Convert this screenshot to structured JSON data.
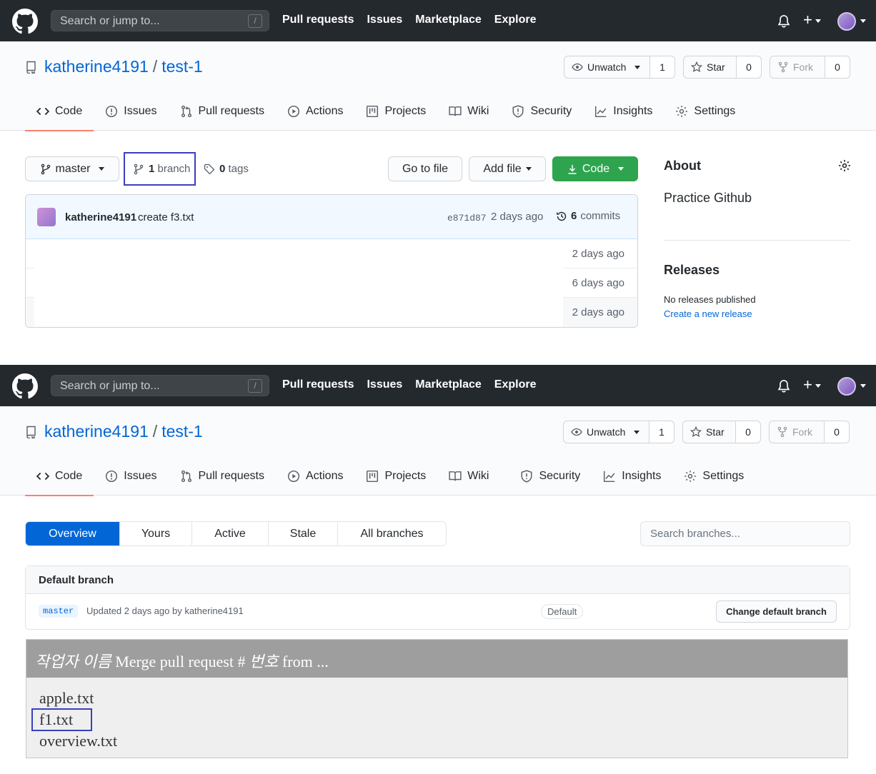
{
  "top_nav": {
    "search_placeholder": "Search or jump to...",
    "slash_key": "/",
    "links": [
      "Pull requests",
      "Issues",
      "Marketplace",
      "Explore"
    ],
    "plus": "+"
  },
  "repo": {
    "owner": "katherine4191",
    "separator": "/",
    "name": "test-1",
    "watch_label": "Unwatch",
    "watch_count": "1",
    "star_label": "Star",
    "star_count": "0",
    "fork_label": "Fork",
    "fork_count": "0"
  },
  "tabs": [
    "Code",
    "Issues",
    "Pull requests",
    "Actions",
    "Projects",
    "Wiki",
    "Security",
    "Insights",
    "Settings"
  ],
  "code_view": {
    "branch_button": "master",
    "branch_count": "1",
    "branch_label": "branch",
    "tag_count": "0",
    "tag_label": "tags",
    "go_to_file": "Go to file",
    "add_file": "Add file",
    "code_button": "Code",
    "commit": {
      "author": "katherine4191",
      "message": "create f3.txt",
      "sha": "e871d87",
      "time": "2 days ago",
      "commit_count": "6",
      "commit_label": "commits"
    },
    "file_times": [
      "2 days ago",
      "6 days ago",
      "2 days ago"
    ]
  },
  "about": {
    "heading": "About",
    "description": "Practice Github",
    "releases_heading": "Releases",
    "releases_none": "No releases published",
    "releases_link": "Create a new release"
  },
  "branches_view": {
    "subnav": [
      "Overview",
      "Yours",
      "Active",
      "Stale",
      "All branches"
    ],
    "search_placeholder": "Search branches...",
    "default_heading": "Default branch",
    "branch_name": "master",
    "updated": "Updated 2 days ago by katherine4191",
    "default_badge": "Default",
    "change_button": "Change default branch"
  },
  "annotation": {
    "header_italic": "작업자 이름",
    "header_mid": " Merge pull request # ",
    "header_italic2": "번호",
    "header_tail": " from ...",
    "files": [
      "apple.txt",
      "f1.txt",
      "overview.txt"
    ]
  },
  "colors": {
    "nav_bg": "#24292e",
    "link_blue": "#0366d6",
    "green": "#2ea44f",
    "tab_underline": "#f9826c",
    "highlight": "#3a3fbf"
  }
}
